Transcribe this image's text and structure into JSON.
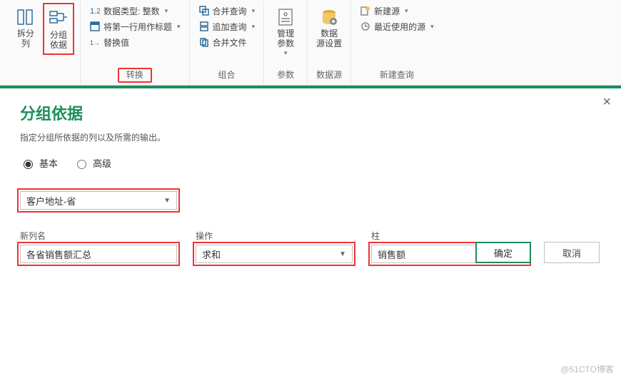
{
  "ribbon": {
    "splitColumn": "拆分\n列",
    "groupBy": "分组\n依据",
    "transform": {
      "caption": "转换",
      "dataType": "数据类型: 整数",
      "useFirstRow": "将第一行用作标题",
      "replaceValues": "替换值"
    },
    "combine": {
      "caption": "组合",
      "mergeQueries": "合并查询",
      "appendQueries": "追加查询",
      "mergeFiles": "合并文件"
    },
    "params": {
      "caption": "参数",
      "manage": "管理\n参数"
    },
    "dataSource": {
      "caption": "数据源",
      "settings": "数据\n源设置"
    },
    "newQuery": {
      "caption": "新建查询",
      "newSource": "新建源",
      "recentSources": "最近使用的源"
    }
  },
  "dialog": {
    "title": "分组依据",
    "desc": "指定分组所依据的列以及所需的输出。",
    "radioBasic": "基本",
    "radioAdvanced": "高级",
    "groupColumn": "客户地址-省",
    "newColLabel": "新列名",
    "newColValue": "各省销售额汇总",
    "opLabel": "操作",
    "opValue": "求和",
    "colLabel": "柱",
    "colValue": "销售额",
    "ok": "确定",
    "cancel": "取消",
    "close": "×"
  },
  "watermark": "@51CTO博客"
}
